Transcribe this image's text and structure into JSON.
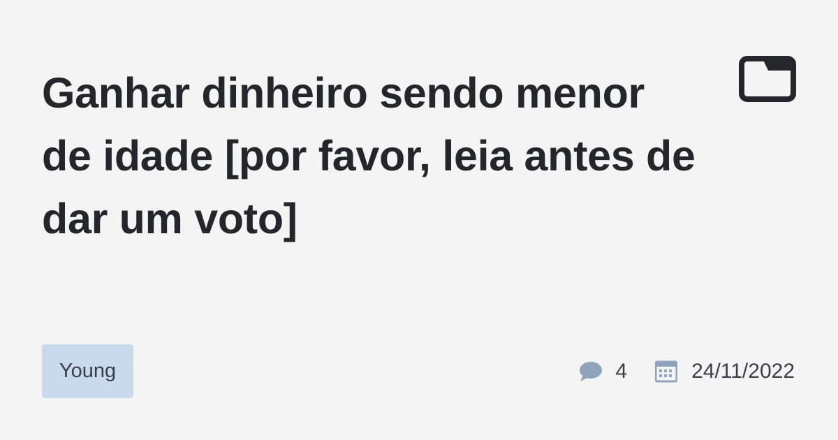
{
  "post": {
    "title": "Ganhar dinheiro sendo menor de idade [por favor, leia antes de dar um voto]",
    "tag": "Young",
    "comment_count": "4",
    "date": "24/11/2022"
  },
  "icons": {
    "category": "folder-icon",
    "comments": "comment-icon",
    "date": "calendar-icon"
  },
  "colors": {
    "background": "#f4f4f4",
    "title_text": "#24262b",
    "tag_background": "#c9daed",
    "meta_icon": "#8fa4bb",
    "meta_text": "#3a3f47"
  }
}
